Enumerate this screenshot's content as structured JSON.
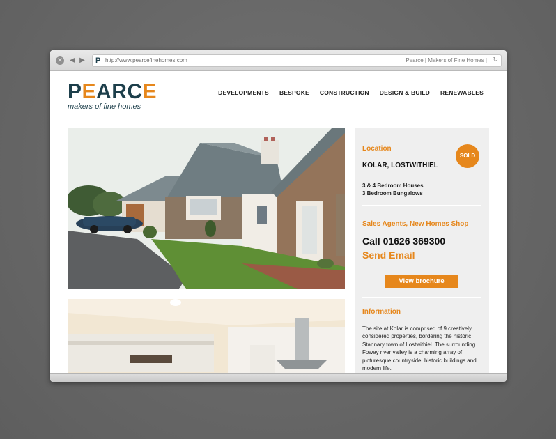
{
  "browser": {
    "url": "http://www.pearcefinehomes.com",
    "tab_title": "Pearce | Makers of Fine Homes |",
    "favicon": "P",
    "icons": [
      "close-icon",
      "back-arrow-icon",
      "forward-arrow-icon",
      "reload-icon"
    ]
  },
  "logo": {
    "word_start": "P",
    "word_accent": "E",
    "word_end": "ARC",
    "word_last_accent": "E",
    "tagline": "makers of fine homes"
  },
  "nav": {
    "items": [
      "DEVELOPMENTS",
      "BESPOKE",
      "CONSTRUCTION",
      "DESIGN & BUILD",
      "RENEWABLES"
    ]
  },
  "sidebar": {
    "location_heading": "Location",
    "status_badge": "SOLD",
    "location_name": "KOLAR, LOSTWITHIEL",
    "details": [
      "3 & 4 Bedroom Houses",
      "3 Bedroom Bungalows"
    ],
    "agents_heading": "Sales Agents, New Homes Shop",
    "call": "Call 01626 369300",
    "email_label": "Send Email",
    "brochure_label": "View brochure",
    "info_heading": "Information",
    "info_text": "The site at Kolar is comprised of 9 creatively considered properties, bordering the historic Stannary town of Lostwithiel. The surrounding Fowey river valley is a charming array of picturesque countryside, historic buildings and modern life."
  },
  "colors": {
    "brand_navy": "#1d3f4b",
    "accent_orange": "#e6871c",
    "sidebar_bg": "#efefef"
  }
}
